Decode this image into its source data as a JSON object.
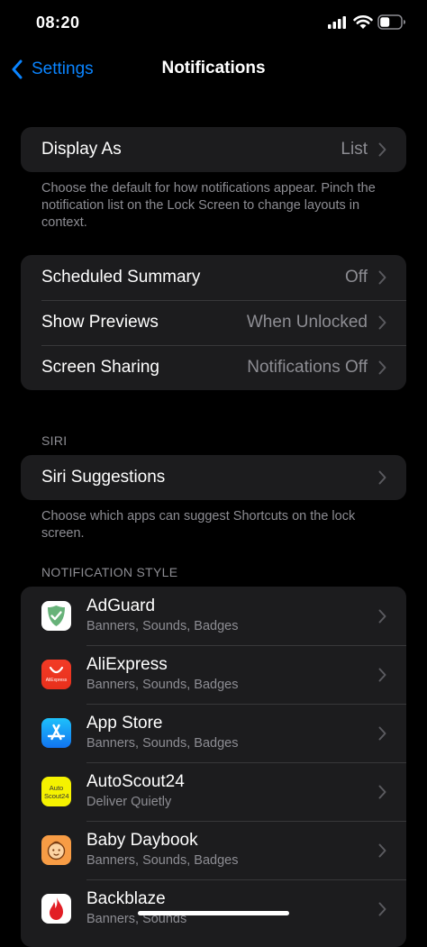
{
  "status_bar": {
    "time": "08:20"
  },
  "nav": {
    "back_label": "Settings",
    "title": "Notifications"
  },
  "display_as": {
    "label": "Display As",
    "value": "List",
    "footnote": "Choose the default for how notifications appear. Pinch the notification list on the Lock Screen to change layouts in context."
  },
  "general_rows": [
    {
      "label": "Scheduled Summary",
      "value": "Off"
    },
    {
      "label": "Show Previews",
      "value": "When Unlocked"
    },
    {
      "label": "Screen Sharing",
      "value": "Notifications Off"
    }
  ],
  "siri": {
    "header": "SIRI",
    "label": "Siri Suggestions",
    "footnote": "Choose which apps can suggest Shortcuts on the lock screen."
  },
  "notification_style": {
    "header": "NOTIFICATION STYLE",
    "apps": [
      {
        "name": "AdGuard",
        "subtitle": "Banners, Sounds, Badges",
        "icon": "adguard-shield-icon"
      },
      {
        "name": "AliExpress",
        "subtitle": "Banners, Sounds, Badges",
        "icon": "aliexpress-icon",
        "icon_text": "AliExpress"
      },
      {
        "name": "App Store",
        "subtitle": "Banners, Sounds, Badges",
        "icon": "app-store-icon"
      },
      {
        "name": "AutoScout24",
        "subtitle": "Deliver Quietly",
        "icon": "autoscout24-icon",
        "icon_text": "Auto Scout24"
      },
      {
        "name": "Baby Daybook",
        "subtitle": "Banners, Sounds, Badges",
        "icon": "baby-face-icon"
      },
      {
        "name": "Backblaze",
        "subtitle": "Banners, Sounds",
        "icon": "flame-icon"
      }
    ]
  },
  "colors": {
    "background": "#000000",
    "cell": "#1c1c1e",
    "accent": "#0a84ff",
    "secondary_text": "#8d8d93"
  }
}
